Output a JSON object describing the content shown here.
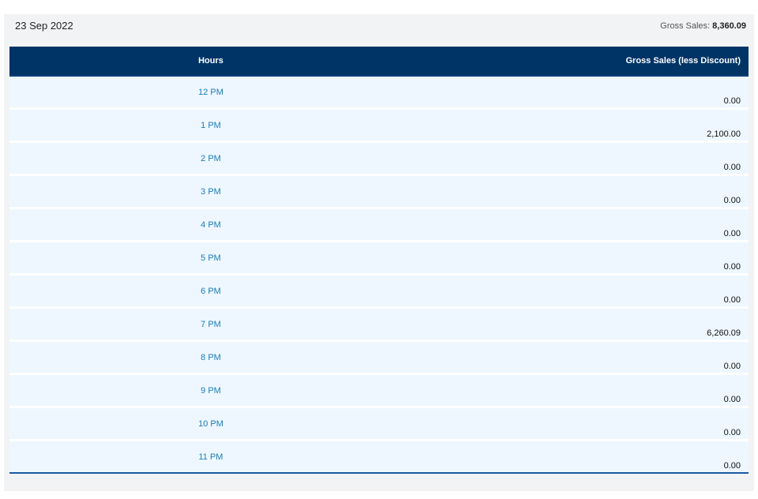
{
  "header": {
    "date": "23 Sep 2022",
    "gross_label": "Gross Sales:",
    "gross_value": "8,360.09"
  },
  "table": {
    "columns": {
      "hours": "Hours",
      "sales": "Gross Sales (less Discount)"
    },
    "rows": [
      {
        "hour": "12 PM",
        "sales": "0.00"
      },
      {
        "hour": "1 PM",
        "sales": "2,100.00"
      },
      {
        "hour": "2 PM",
        "sales": "0.00"
      },
      {
        "hour": "3 PM",
        "sales": "0.00"
      },
      {
        "hour": "4 PM",
        "sales": "0.00"
      },
      {
        "hour": "5 PM",
        "sales": "0.00"
      },
      {
        "hour": "6 PM",
        "sales": "0.00"
      },
      {
        "hour": "7 PM",
        "sales": "6,260.09"
      },
      {
        "hour": "8 PM",
        "sales": "0.00"
      },
      {
        "hour": "9 PM",
        "sales": "0.00"
      },
      {
        "hour": "10 PM",
        "sales": "0.00"
      },
      {
        "hour": "11 PM",
        "sales": "0.00"
      }
    ]
  },
  "colors": {
    "header_bg": "#003466",
    "row_bg": "#eef7ff",
    "link": "#1a7dbb",
    "panel_bg": "#f2f3f4"
  }
}
